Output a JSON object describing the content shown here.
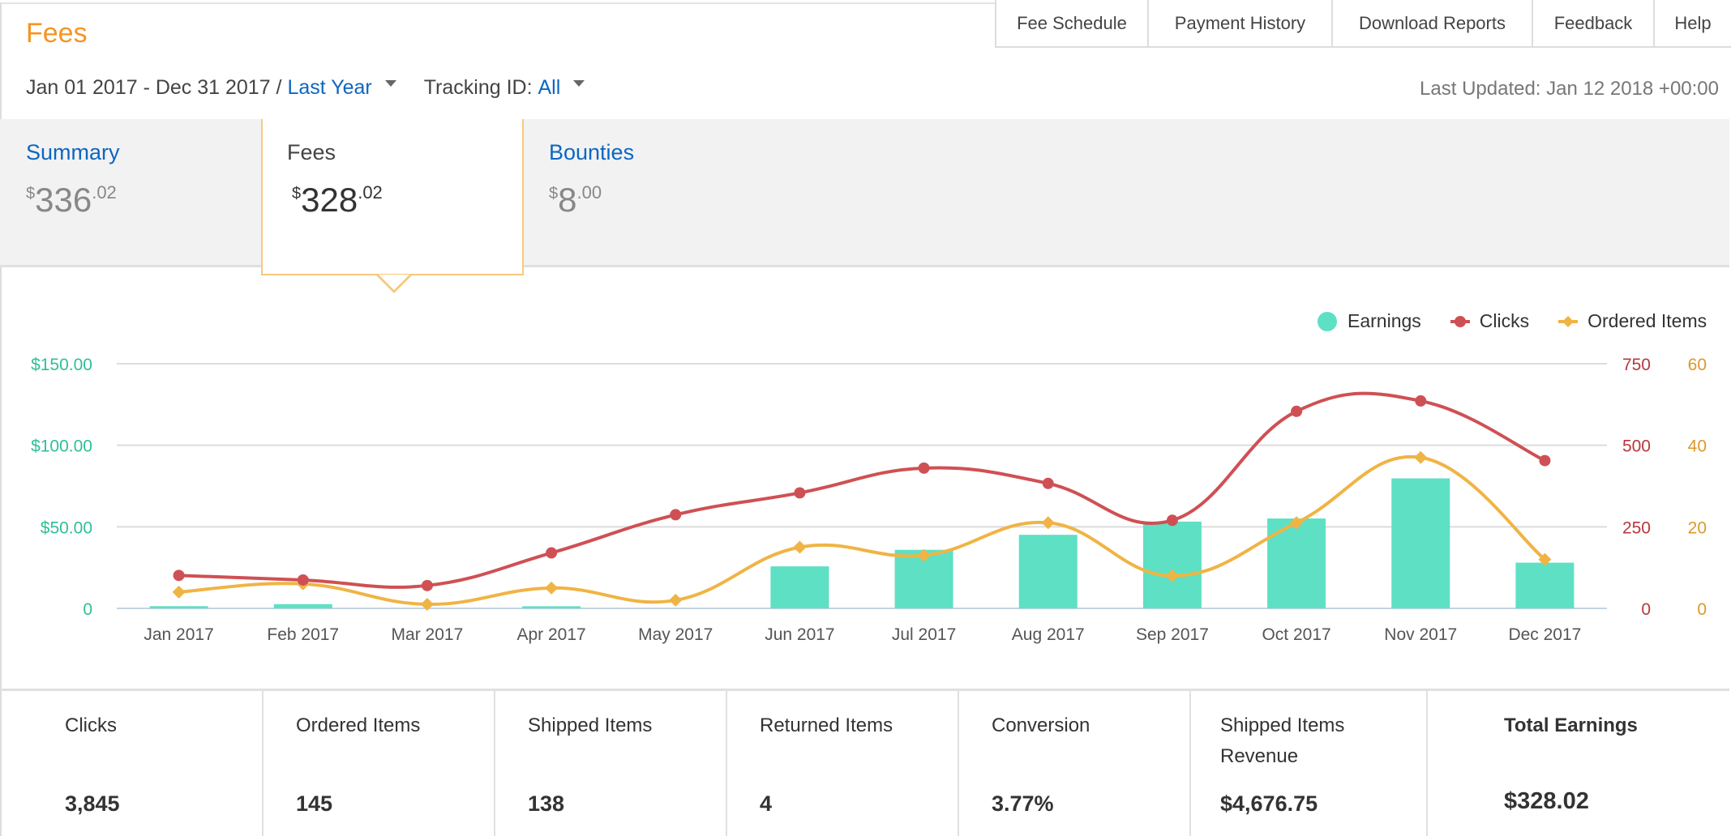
{
  "header": {
    "title": "Fees",
    "nav": [
      "Fee Schedule",
      "Payment History",
      "Download Reports",
      "Feedback",
      "Help"
    ],
    "date_range": "Jan 01 2017 - Dec 31 2017 / ",
    "date_preset": "Last Year",
    "tracking_label": "Tracking ID: ",
    "tracking_value": "All",
    "last_updated": "Last Updated: Jan 12 2018 +00:00"
  },
  "tabs": [
    {
      "label": "Summary",
      "currency": "$",
      "int": "336",
      "dec": ".02",
      "active": false
    },
    {
      "label": "Fees",
      "currency": "$",
      "int": "328",
      "dec": ".02",
      "active": true
    },
    {
      "label": "Bounties",
      "currency": "$",
      "int": "8",
      "dec": ".00",
      "active": false
    }
  ],
  "legend": [
    "Earnings",
    "Clicks",
    "Ordered Items"
  ],
  "colors": {
    "earnings": "#5ee0c4",
    "clicks": "#cf5054",
    "ordered": "#f0b444",
    "earnings_axis": "#2fbf97",
    "clicks_axis": "#b7373d",
    "ordered_axis": "#d99a2b",
    "accent_orange": "#f79420",
    "link_blue": "#0c66c2"
  },
  "chart_data": {
    "type": "bar",
    "title": "",
    "categories": [
      "Jan 2017",
      "Feb 2017",
      "Mar 2017",
      "Apr 2017",
      "May 2017",
      "Jun 2017",
      "Jul 2017",
      "Aug 2017",
      "Sep 2017",
      "Oct 2017",
      "Nov 2017",
      "Dec 2017"
    ],
    "series": [
      {
        "name": "Earnings",
        "type": "bar",
        "axis": "left",
        "values": [
          1.35,
          2.6,
          0.0,
          1.3,
          0.0,
          25.75,
          35.9,
          45.1,
          53.2,
          55.1,
          79.7,
          28.02
        ]
      },
      {
        "name": "Clicks",
        "type": "line",
        "axis": "right1",
        "values": [
          101,
          87,
          70,
          170,
          287,
          354,
          430,
          383,
          270,
          604,
          636,
          453
        ]
      },
      {
        "name": "Ordered Items",
        "type": "line",
        "axis": "right2",
        "values": [
          4,
          6,
          1,
          5,
          2,
          15,
          13,
          21,
          8,
          21,
          37,
          12
        ]
      }
    ],
    "axes": {
      "left": {
        "ylim": [
          0,
          150
        ],
        "ticks": [
          "0",
          "$50.00",
          "$100.00",
          "$150.00"
        ]
      },
      "right1": {
        "ylim": [
          0,
          750
        ],
        "ticks": [
          "0",
          "250",
          "500",
          "750"
        ]
      },
      "right2": {
        "ylim": [
          0,
          60
        ],
        "ticks": [
          "0",
          "20",
          "40",
          "60"
        ]
      }
    },
    "grid": true,
    "legend_position": "top-right"
  },
  "stats": [
    {
      "label": "Clicks",
      "value": "3,845"
    },
    {
      "label": "Ordered Items",
      "value": "145"
    },
    {
      "label": "Shipped Items",
      "value": "138"
    },
    {
      "label": "Returned Items",
      "value": "4"
    },
    {
      "label": "Conversion",
      "value": "3.77%"
    },
    {
      "label": "Shipped Items Revenue",
      "value": "$4,676.75"
    },
    {
      "label": "Total Earnings",
      "value": "$328.02"
    }
  ]
}
